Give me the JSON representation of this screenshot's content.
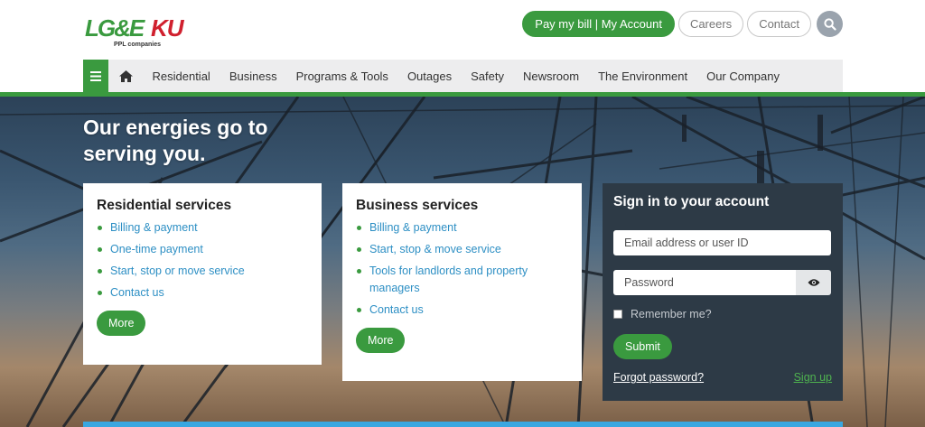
{
  "brand": {
    "lge": "LG&E",
    "ku": "KU",
    "tagline": "PPL companies"
  },
  "header": {
    "pay_label": "Pay my bill | My Account",
    "careers_label": "Careers",
    "contact_label": "Contact"
  },
  "nav": {
    "items": [
      "Residential",
      "Business",
      "Programs & Tools",
      "Outages",
      "Safety",
      "Newsroom",
      "The Environment",
      "Our Company"
    ]
  },
  "hero": {
    "title": "Our energies go to serving you."
  },
  "residential": {
    "title": "Residential services",
    "links": [
      "Billing & payment",
      "One-time payment",
      "Start, stop or move service",
      "Contact us"
    ],
    "more_label": "More"
  },
  "business": {
    "title": "Business services",
    "links": [
      "Billing & payment",
      "Start, stop & move service",
      "Tools for landlords and property managers",
      "Contact us"
    ],
    "more_label": "More"
  },
  "signin": {
    "title": "Sign in to your account",
    "email_placeholder": "Email address or user ID",
    "password_placeholder": "Password",
    "remember_label": "Remember me?",
    "submit_label": "Submit",
    "forgot_label": "Forgot password?",
    "signup_label": "Sign up"
  },
  "colors": {
    "accent": "#3a9a3f",
    "link": "#2d8fc4",
    "panel": "#2d3a46",
    "ku_red": "#d0202e"
  },
  "icons": {
    "menu": "hamburger-icon",
    "home": "home-icon",
    "search": "search-icon",
    "eye": "eye-icon"
  }
}
